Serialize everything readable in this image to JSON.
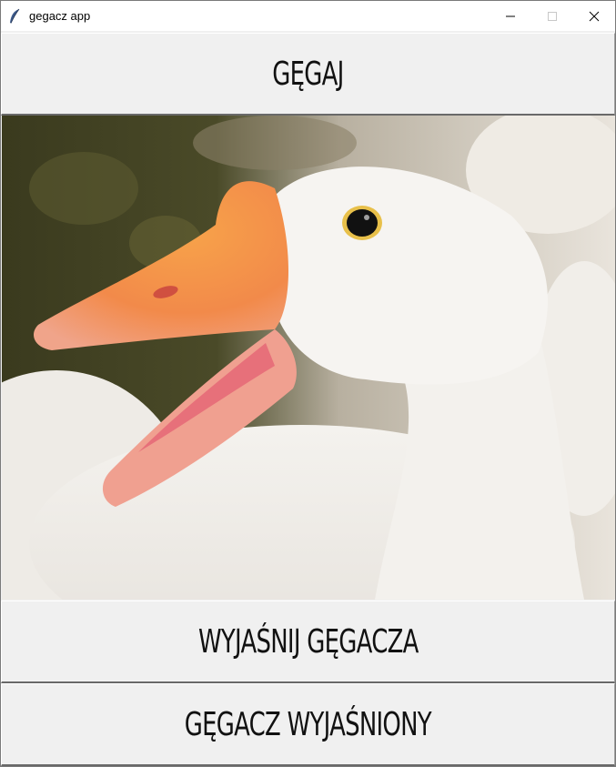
{
  "window": {
    "title": "gegacz app",
    "app_icon": "feather-icon",
    "controls": [
      "minimize-icon",
      "maximize-icon",
      "close-icon"
    ]
  },
  "buttons": {
    "gegaj": "GĘGAJ",
    "wyjasnij": "WYJAŚNIJ GĘGACZA",
    "wyjasniony": "GĘGACZ WYJAŚNIONY"
  },
  "image": {
    "subject": "white goose with open orange beak"
  },
  "colors": {
    "titlebar": "#ffffff",
    "button_face": "#f0f0f0",
    "text": "#111111"
  }
}
